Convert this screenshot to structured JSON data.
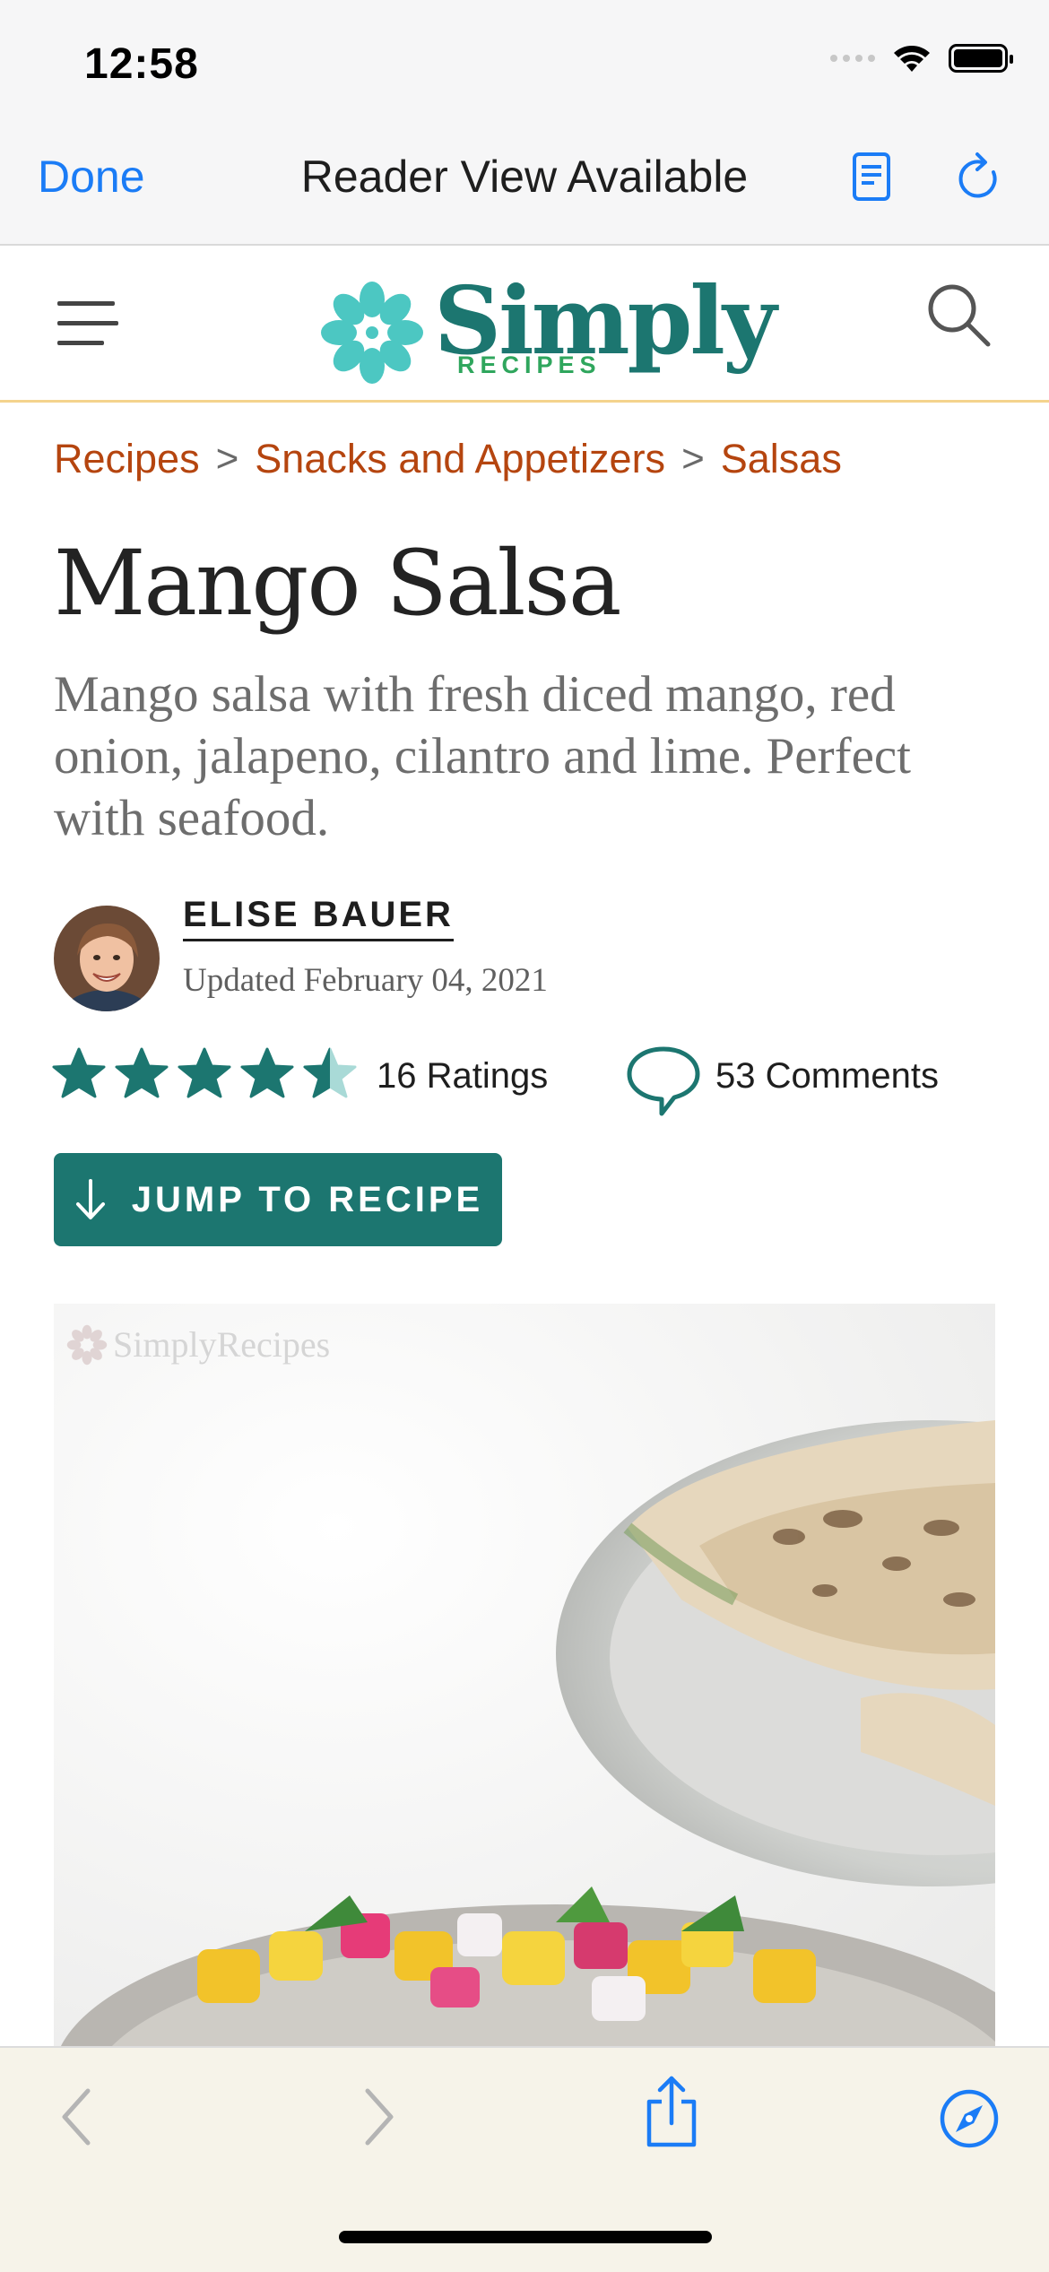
{
  "status_bar": {
    "time": "12:58"
  },
  "browser": {
    "done_label": "Done",
    "title": "Reader View Available",
    "accent": "#1b7cf6"
  },
  "site": {
    "logo_word": "Simply",
    "logo_sub": "RECIPES",
    "brand_color": "#1c7670"
  },
  "breadcrumb": {
    "items": [
      "Recipes",
      "Snacks and Appetizers",
      "Salsas"
    ],
    "separator": ">"
  },
  "article": {
    "title": "Mango Salsa",
    "description": "Mango salsa with fresh diced mango, red onion, jalapeno, cilantro and lime. Perfect with seafood.",
    "author": "ELISE BAUER",
    "updated": "Updated February 04, 2021",
    "rating_value": 4.5,
    "ratings_label": "16 Ratings",
    "comments_label": "53 Comments",
    "jump_label": "JUMP TO RECIPE"
  },
  "hero": {
    "watermark": "SimplyRecipes"
  },
  "icons": {
    "reader": "reader-view-icon",
    "reload": "reload-icon",
    "menu": "hamburger-menu-icon",
    "search": "search-icon",
    "comment": "speech-bubble-icon",
    "jump": "arrow-down-icon",
    "back": "chevron-left-icon",
    "forward": "chevron-right-icon",
    "share": "share-icon",
    "safari": "compass-icon"
  }
}
